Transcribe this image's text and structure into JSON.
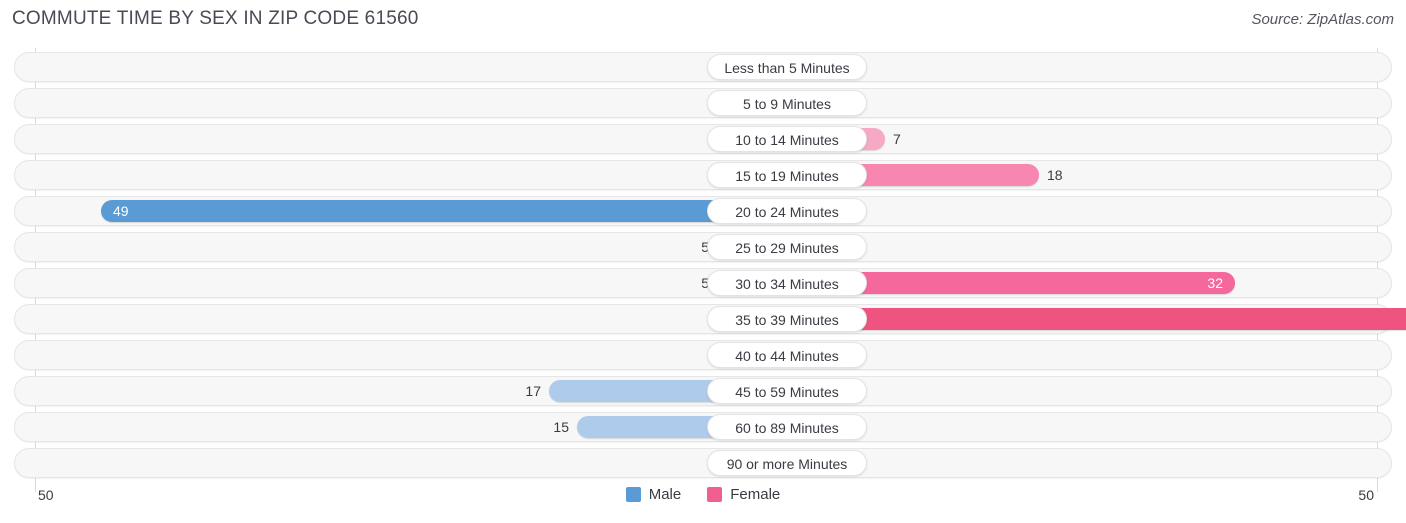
{
  "header": {
    "title": "COMMUTE TIME BY SEX IN ZIP CODE 61560",
    "source": "Source: ZipAtlas.com"
  },
  "legend": {
    "male_label": "Male",
    "female_label": "Female",
    "male_color": "#5b9bd5",
    "female_color": "#ef5f92"
  },
  "axis": {
    "left_label": "50",
    "right_label": "50",
    "max": 50
  },
  "chart_data": {
    "type": "bar",
    "orientation": "horizontal-diverging",
    "title": "COMMUTE TIME BY SEX IN ZIP CODE 61560",
    "xlabel": "",
    "ylabel": "",
    "xlim": [
      50,
      50
    ],
    "grid": true,
    "legend_position": "bottom-center",
    "categories": [
      "Less than 5 Minutes",
      "5 to 9 Minutes",
      "10 to 14 Minutes",
      "15 to 19 Minutes",
      "20 to 24 Minutes",
      "25 to 29 Minutes",
      "30 to 34 Minutes",
      "35 to 39 Minutes",
      "40 to 44 Minutes",
      "45 to 59 Minutes",
      "60 to 89 Minutes",
      "90 or more Minutes"
    ],
    "series": [
      {
        "name": "Male",
        "values": [
          0,
          0,
          0,
          0,
          49,
          5,
          5,
          0,
          0,
          17,
          15,
          0
        ]
      },
      {
        "name": "Female",
        "values": [
          0,
          0,
          7,
          18,
          0,
          0,
          32,
          50,
          0,
          0,
          0,
          0
        ]
      }
    ]
  },
  "rows": [
    {
      "label": "Less than 5 Minutes",
      "male": "0",
      "female": "0"
    },
    {
      "label": "5 to 9 Minutes",
      "male": "0",
      "female": "0"
    },
    {
      "label": "10 to 14 Minutes",
      "male": "0",
      "female": "7"
    },
    {
      "label": "15 to 19 Minutes",
      "male": "0",
      "female": "18"
    },
    {
      "label": "20 to 24 Minutes",
      "male": "49",
      "female": "0"
    },
    {
      "label": "25 to 29 Minutes",
      "male": "5",
      "female": "0"
    },
    {
      "label": "30 to 34 Minutes",
      "male": "5",
      "female": "32"
    },
    {
      "label": "35 to 39 Minutes",
      "male": "0",
      "female": "50"
    },
    {
      "label": "40 to 44 Minutes",
      "male": "0",
      "female": "0"
    },
    {
      "label": "45 to 59 Minutes",
      "male": "17",
      "female": "0"
    },
    {
      "label": "60 to 89 Minutes",
      "male": "15",
      "female": "0"
    },
    {
      "label": "90 or more Minutes",
      "male": "0",
      "female": "0"
    }
  ]
}
